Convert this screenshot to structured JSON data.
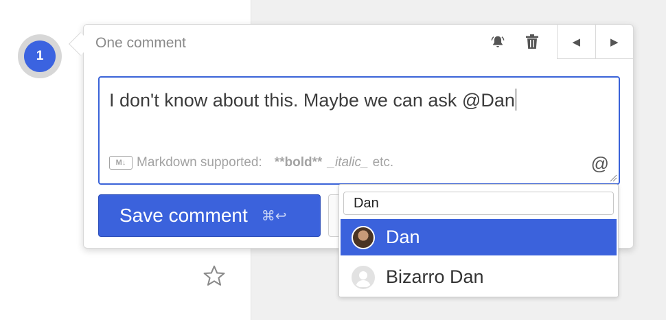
{
  "marker": {
    "number": "1"
  },
  "popover": {
    "title": "One comment",
    "icons": [
      "bell-icon",
      "trash-icon"
    ],
    "nav": {
      "prev": "◀",
      "next": "▶"
    }
  },
  "editor": {
    "text": "I don't know about this. Maybe we can ask @Dan",
    "markdown_badge": "M↓",
    "markdown_label": "Markdown supported:",
    "markdown_bold": "**bold**",
    "markdown_italic": "_italic_",
    "markdown_etc": "etc.",
    "at_symbol": "@"
  },
  "actions": {
    "save_label": "Save comment",
    "save_shortcut": "⌘↩"
  },
  "mention": {
    "query": "Dan",
    "results": [
      {
        "name": "Dan",
        "avatar": "photo",
        "selected": true
      },
      {
        "name": "Bizarro Dan",
        "avatar": "default",
        "selected": false
      }
    ]
  },
  "colors": {
    "accent": "#3b62dc",
    "marker": "#3b63e0",
    "background_panel": "#f0f0f0"
  }
}
